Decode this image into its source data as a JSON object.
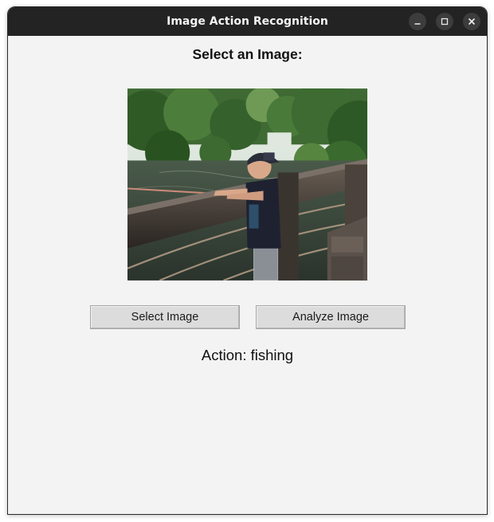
{
  "window": {
    "title": "Image Action Recognition"
  },
  "main": {
    "heading": "Select an Image:",
    "buttons": {
      "select_label": "Select Image",
      "analyze_label": "Analyze Image"
    },
    "result": {
      "text": "Action: fishing"
    },
    "image": {
      "subject": "boy-fishing-from-wooden-bridge"
    }
  },
  "colors": {
    "titlebar": "#232323",
    "window_bg": "#f3f3f3",
    "button_bg": "#dcdcdc"
  },
  "icons": {
    "minimize": "minimize-icon",
    "maximize": "maximize-icon",
    "close": "close-icon"
  }
}
